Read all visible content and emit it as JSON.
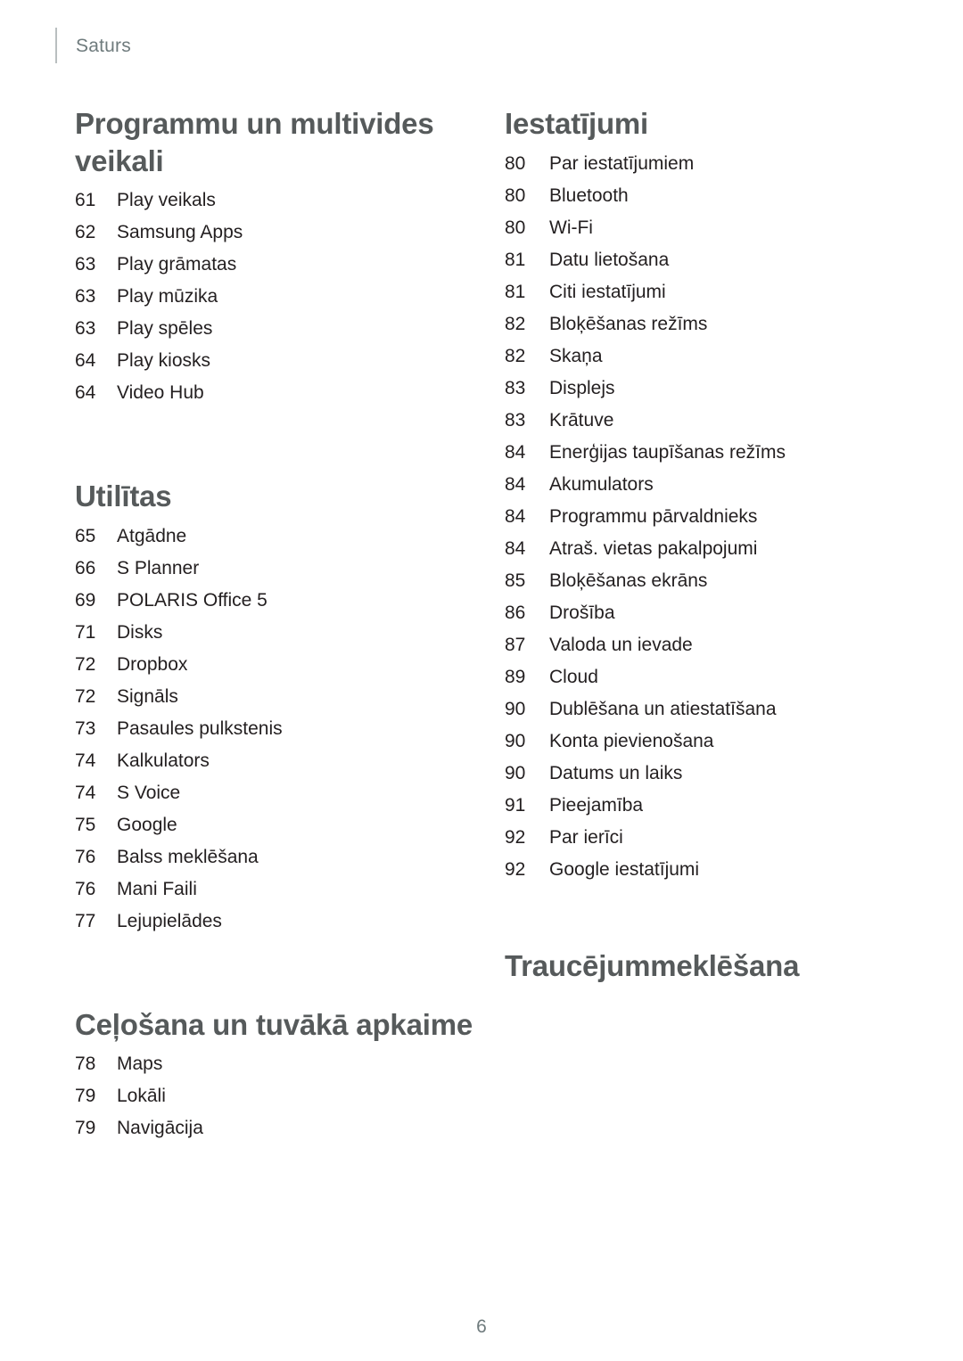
{
  "header": {
    "running_title": "Saturs"
  },
  "footer": {
    "page_number": "6"
  },
  "colors": {
    "heading": "#565a5b",
    "body_text": "#231f20",
    "muted": "#6f7b7d",
    "rule": "#b9bfc0",
    "background": "#ffffff"
  },
  "columns": {
    "left": [
      {
        "title": "Programmu un multivides veikali",
        "entries": [
          {
            "page": "61",
            "label": "Play veikals"
          },
          {
            "page": "62",
            "label": "Samsung Apps"
          },
          {
            "page": "63",
            "label": "Play grāmatas"
          },
          {
            "page": "63",
            "label": "Play mūzika"
          },
          {
            "page": "63",
            "label": "Play spēles"
          },
          {
            "page": "64",
            "label": "Play kiosks"
          },
          {
            "page": "64",
            "label": "Video Hub"
          }
        ]
      },
      {
        "title": "Utilītas",
        "entries": [
          {
            "page": "65",
            "label": "Atgādne"
          },
          {
            "page": "66",
            "label": "S Planner"
          },
          {
            "page": "69",
            "label": "POLARIS Office 5"
          },
          {
            "page": "71",
            "label": "Disks"
          },
          {
            "page": "72",
            "label": "Dropbox"
          },
          {
            "page": "72",
            "label": "Signāls"
          },
          {
            "page": "73",
            "label": "Pasaules pulkstenis"
          },
          {
            "page": "74",
            "label": "Kalkulators"
          },
          {
            "page": "74",
            "label": "S Voice"
          },
          {
            "page": "75",
            "label": "Google"
          },
          {
            "page": "76",
            "label": "Balss meklēšana"
          },
          {
            "page": "76",
            "label": "Mani Faili"
          },
          {
            "page": "77",
            "label": "Lejupielādes"
          }
        ]
      },
      {
        "title": "Ceļošana un tuvākā apkaime",
        "entries": [
          {
            "page": "78",
            "label": "Maps"
          },
          {
            "page": "79",
            "label": "Lokāli"
          },
          {
            "page": "79",
            "label": "Navigācija"
          }
        ]
      }
    ],
    "right": [
      {
        "title": "Iestatījumi",
        "entries": [
          {
            "page": "80",
            "label": "Par iestatījumiem"
          },
          {
            "page": "80",
            "label": "Bluetooth"
          },
          {
            "page": "80",
            "label": "Wi-Fi"
          },
          {
            "page": "81",
            "label": "Datu lietošana"
          },
          {
            "page": "81",
            "label": "Citi iestatījumi"
          },
          {
            "page": "82",
            "label": "Bloķēšanas režīms"
          },
          {
            "page": "82",
            "label": "Skaņa"
          },
          {
            "page": "83",
            "label": "Displejs"
          },
          {
            "page": "83",
            "label": "Krātuve"
          },
          {
            "page": "84",
            "label": "Enerģijas taupīšanas režīms"
          },
          {
            "page": "84",
            "label": "Akumulators"
          },
          {
            "page": "84",
            "label": "Programmu pārvaldnieks"
          },
          {
            "page": "84",
            "label": "Atraš. vietas pakalpojumi"
          },
          {
            "page": "85",
            "label": "Bloķēšanas ekrāns"
          },
          {
            "page": "86",
            "label": "Drošība"
          },
          {
            "page": "87",
            "label": "Valoda un ievade"
          },
          {
            "page": "89",
            "label": "Cloud"
          },
          {
            "page": "90",
            "label": "Dublēšana un atiestatīšana"
          },
          {
            "page": "90",
            "label": "Konta pievienošana"
          },
          {
            "page": "90",
            "label": "Datums un laiks"
          },
          {
            "page": "91",
            "label": "Pieejamība"
          },
          {
            "page": "92",
            "label": "Par ierīci"
          },
          {
            "page": "92",
            "label": "Google iestatījumi"
          }
        ]
      },
      {
        "title": "Traucējummeklēšana",
        "entries": []
      }
    ]
  }
}
